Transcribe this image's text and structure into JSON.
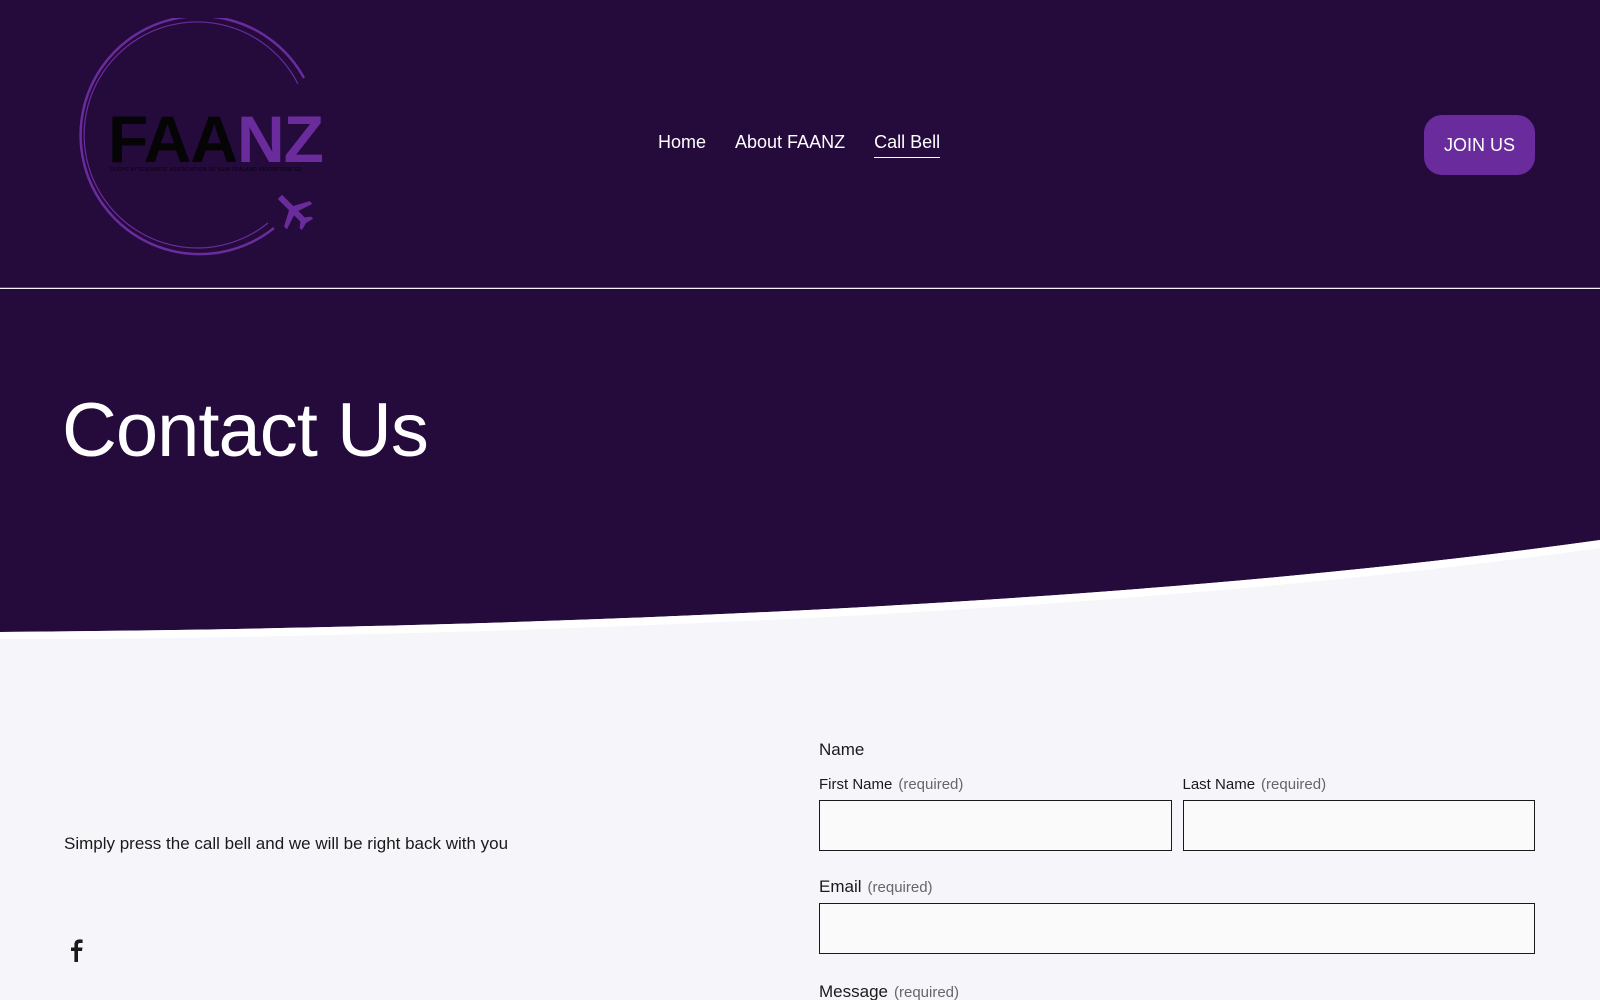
{
  "colors": {
    "header_bg": "#250a3c",
    "accent": "#6a2c9c",
    "page_bg": "#f6f6fa"
  },
  "logo": {
    "name_part1": "FAA",
    "name_part2": "NZ",
    "subtitle": "FLIGHT ATTENDANTS' ASSOCIATION OF NEW ZEALAND INCORPORATED",
    "icon": "airplane-icon"
  },
  "nav": {
    "items": [
      {
        "label": "Home"
      },
      {
        "label": "About FAANZ"
      },
      {
        "label": "Call Bell"
      }
    ]
  },
  "join_button": {
    "label": "JOIN US"
  },
  "hero": {
    "title": "Contact Us"
  },
  "contact": {
    "tagline": "Simply press the call bell and we will be right back with you",
    "social_icon": "facebook-icon"
  },
  "form": {
    "name_label": "Name",
    "first_name_label": "First Name",
    "last_name_label": "Last Name",
    "email_label": "Email",
    "message_label": "Message",
    "required_text": "(required)",
    "first_name_value": "",
    "last_name_value": "",
    "email_value": ""
  }
}
